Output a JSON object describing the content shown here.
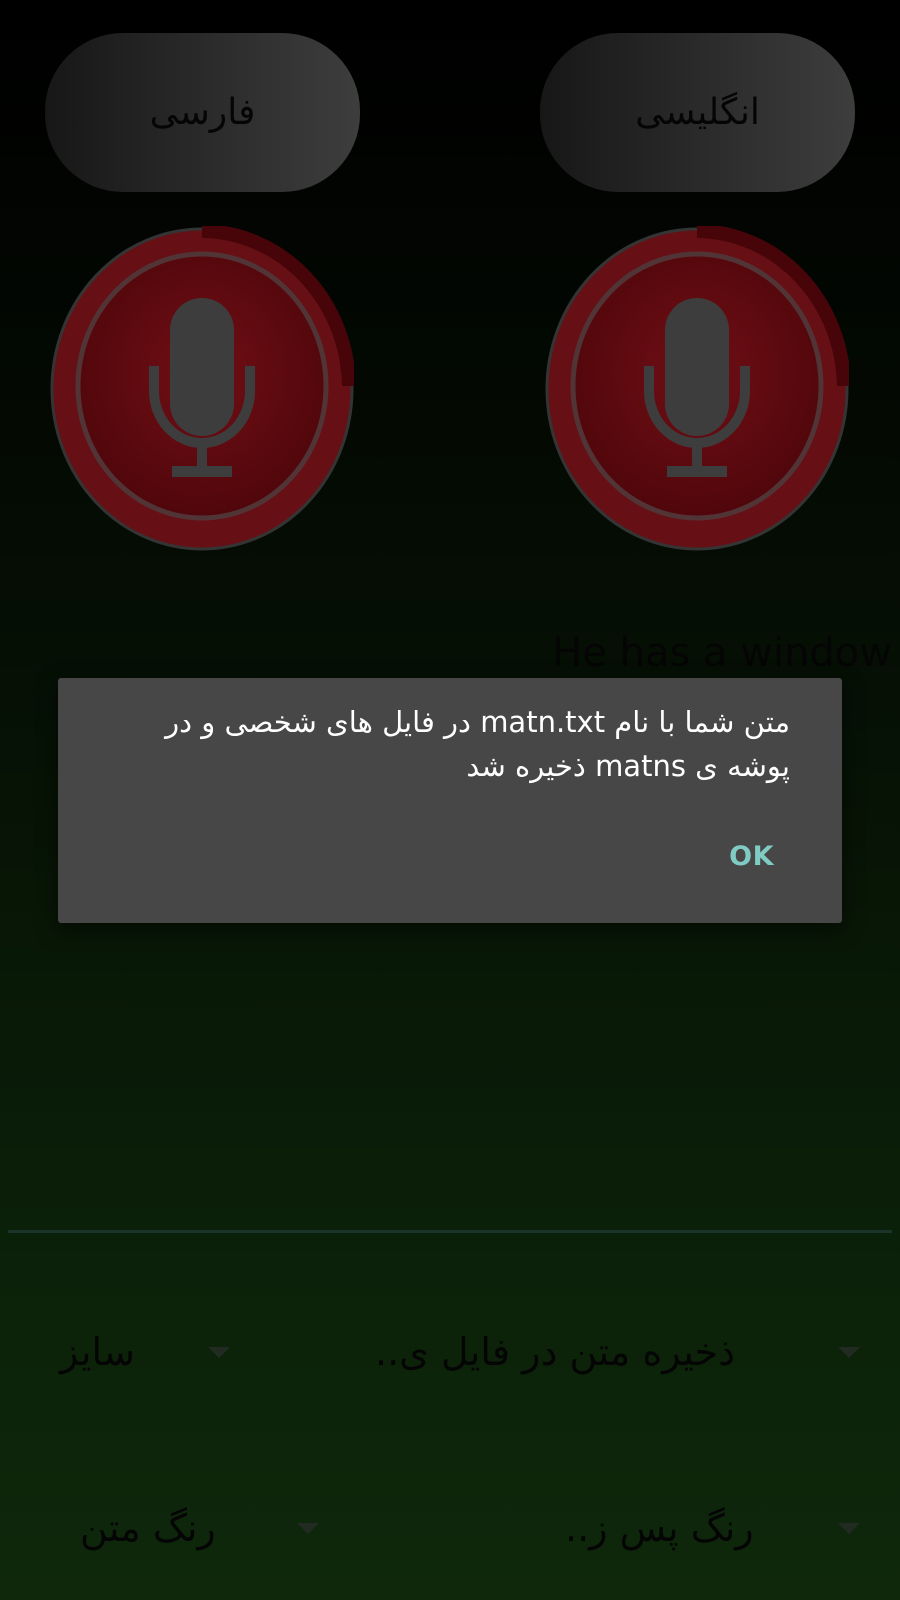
{
  "language_buttons": {
    "persian_label": "فارسی",
    "english_label": "انگلیسی"
  },
  "recognized_text": "He has a window",
  "options": {
    "save_to_file": "ذخیره متن در فایل ی..",
    "size": "سایز",
    "background_color": "رنگ پس ز..",
    "text_color": "رنگ متن"
  },
  "dialog": {
    "message": "متن شما با نام matn.txt در فایل های شخصی و در پوشه ی matns ذخیره شد",
    "ok_label": "OK"
  },
  "colors": {
    "mic_red": "#8b0d15",
    "dialog_bg": "#474747",
    "accent_teal": "#80cbc4"
  },
  "icons": {
    "mic": "microphone-icon",
    "dropdown": "dropdown-arrow-icon"
  }
}
